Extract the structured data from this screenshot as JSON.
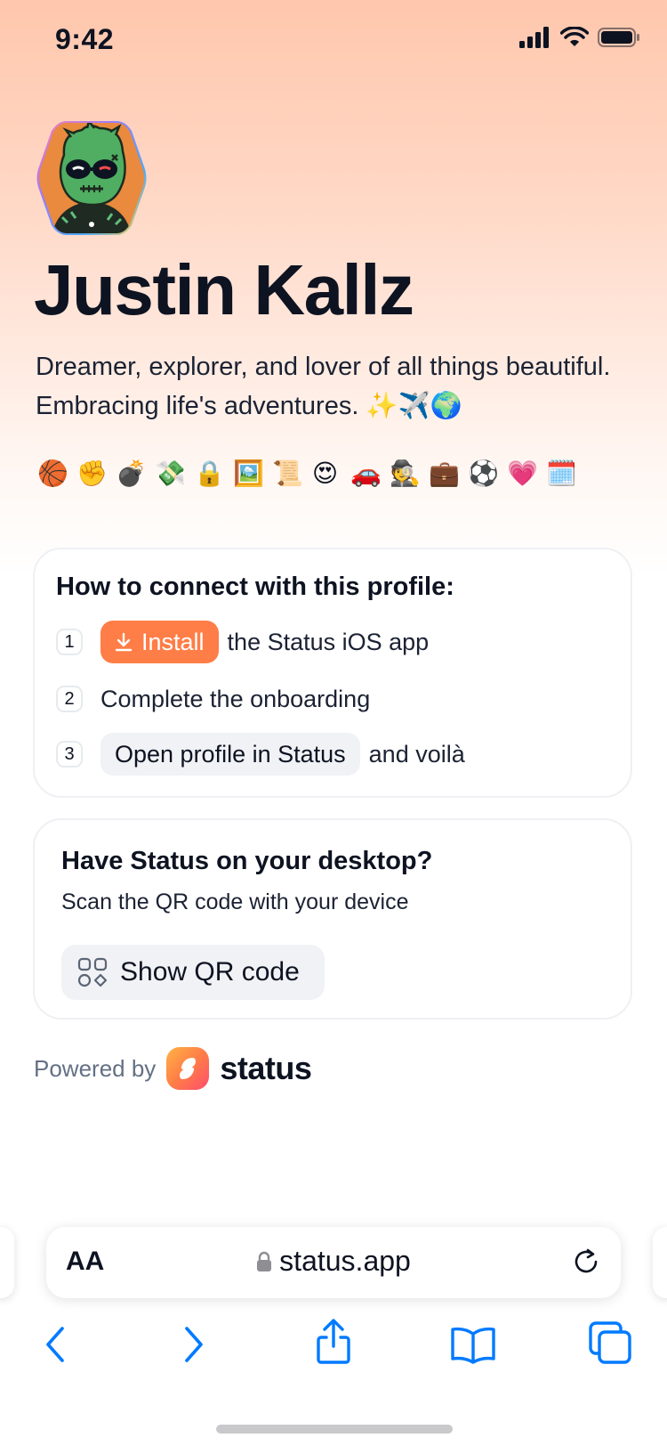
{
  "status_bar": {
    "time": "9:42"
  },
  "profile": {
    "name": "Justin Kallz",
    "bio": "Dreamer, explorer, and lover of all things beautiful. Embracing life's adventures. ✨✈️🌍",
    "emojis": [
      "🏀",
      "✊",
      "💣",
      "💸",
      "🔒",
      "🖼️",
      "📜",
      "😍",
      "🚗",
      "🕵️",
      "💼",
      "⚽",
      "💗",
      "🗓️"
    ]
  },
  "connect_card": {
    "title": "How to connect with this profile:",
    "steps": [
      {
        "num": "1",
        "button": "Install",
        "text": "the Status iOS app"
      },
      {
        "num": "2",
        "text": "Complete the onboarding"
      },
      {
        "num": "3",
        "button": "Open profile in Status",
        "text": "and voilà"
      }
    ]
  },
  "desktop_card": {
    "title": "Have Status on your desktop?",
    "subtitle": "Scan the QR code with your device",
    "button": "Show QR code"
  },
  "footer": {
    "powered_by": "Powered by",
    "brand": "status"
  },
  "browser": {
    "aa_label": "AA",
    "url": "status.app"
  },
  "colors": {
    "accent": "#ff7d46",
    "ios_blue": "#007aff"
  }
}
